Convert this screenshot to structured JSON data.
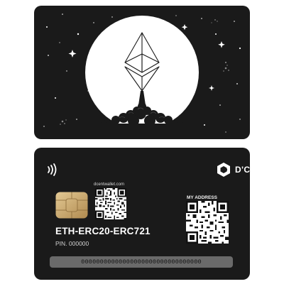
{
  "front": {
    "logo_icon": "ethereum-diamond-icon"
  },
  "back": {
    "brand": {
      "name": "D'CENT",
      "logo_icon": "dcent-logo-icon"
    },
    "nfc_icon": "contactless-icon",
    "chip_icon": "smart-chip-icon",
    "website": "dcentwallet.com",
    "my_address_label": "MY ADDRESS",
    "token_standard": "ETH-ERC20-ERC721",
    "pin_label": "PIN. 000000",
    "serial": "00000000000000000000000000000000"
  },
  "colors": {
    "card": "#1a1a1a",
    "moon": "#ffffff",
    "serial_bar": "#6a6a6a",
    "chip_gold": "#c9a96a"
  }
}
